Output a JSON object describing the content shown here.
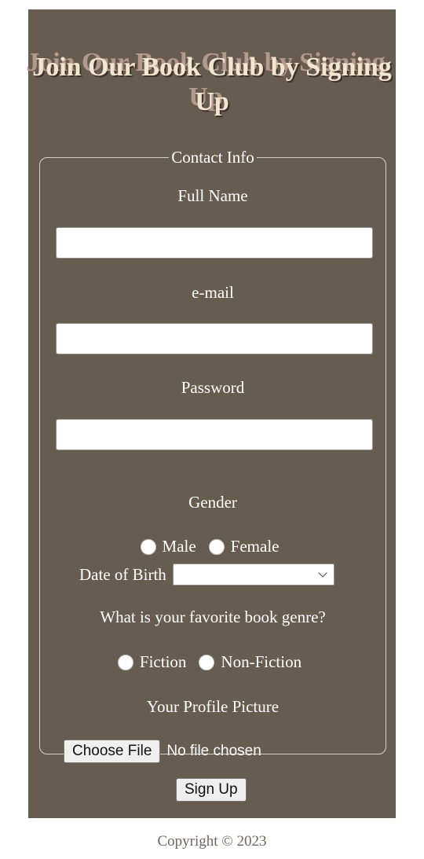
{
  "header": {
    "title": "Join Our Book Club by Signing Up"
  },
  "contact": {
    "legend": "Contact Info",
    "full_name_label": "Full Name",
    "email_label": "e-mail",
    "password_label": "Password",
    "gender_label": "Gender",
    "gender_options": [
      "Male",
      "Female"
    ],
    "dob_label": "Date of Birth",
    "genre_question": "What is your favorite book genre?",
    "genre_options": [
      "Fiction",
      "Non-Fiction"
    ],
    "profile_label": "Your Profile Picture",
    "choose_file_label": "Choose File",
    "file_status": "No file chosen"
  },
  "actions": {
    "signup_label": "Sign Up"
  },
  "footer": {
    "copyright": "Copyright © 2023"
  },
  "colors": {
    "panel_bg": "#675c50",
    "title_fg": "#f3e6d0",
    "title_shadow": "#b59a8c"
  }
}
